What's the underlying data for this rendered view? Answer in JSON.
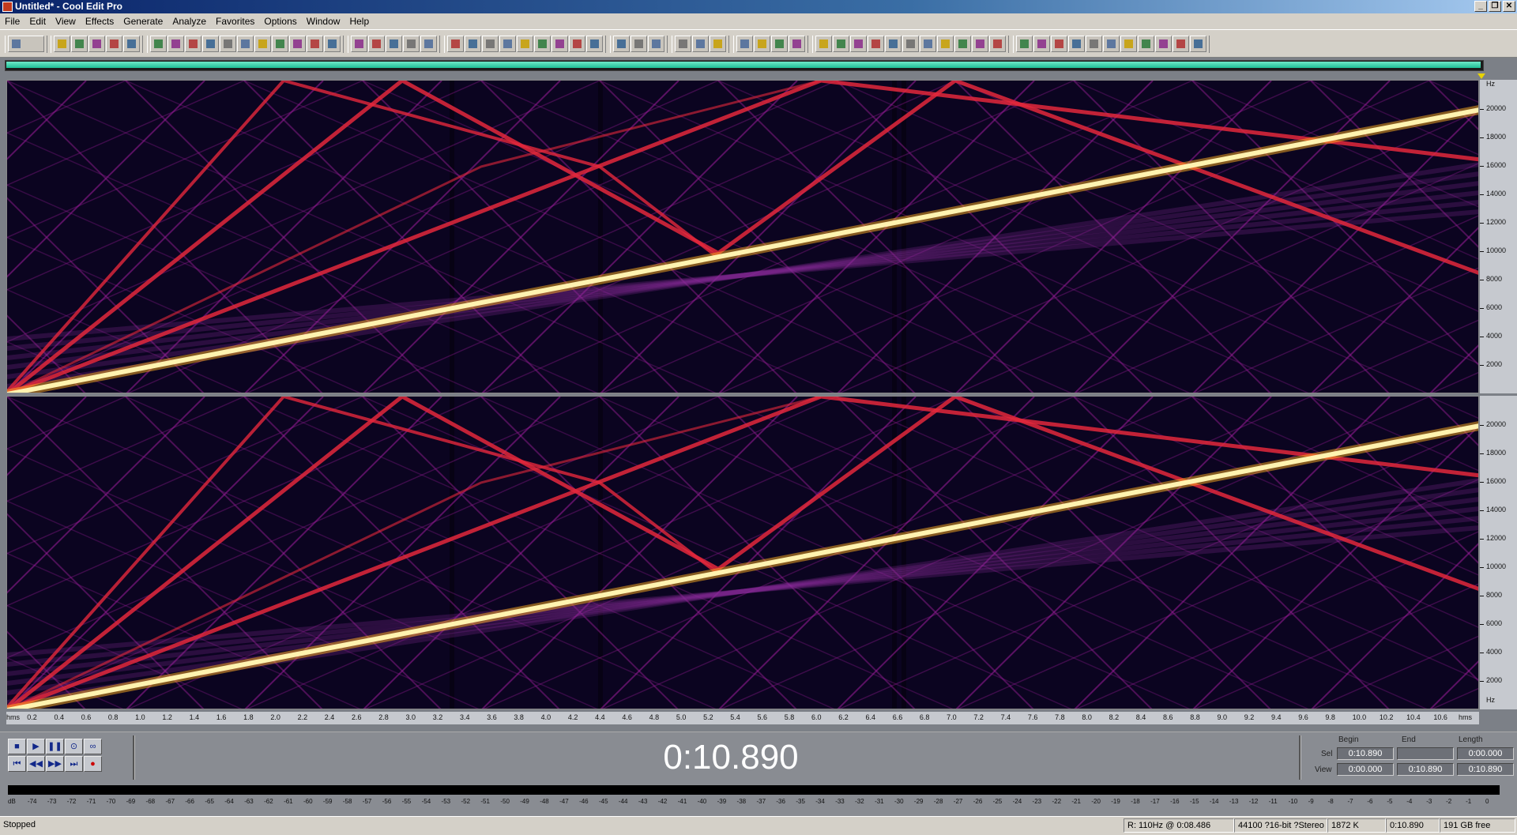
{
  "window": {
    "title": "Untitled* - Cool Edit Pro",
    "min_glyph": "_",
    "max_glyph": "❐",
    "close_glyph": "✕"
  },
  "menu": [
    "File",
    "Edit",
    "View",
    "Effects",
    "Generate",
    "Analyze",
    "Favorites",
    "Options",
    "Window",
    "Help"
  ],
  "toolbar": {
    "groups": [
      {
        "count": 1,
        "wide": true,
        "icons": [
          "waveform-view-icon"
        ]
      },
      {
        "count": 5,
        "icons": [
          "new-file-icon",
          "open-file-icon",
          "save-icon",
          "save-as-icon",
          "close-file-icon"
        ]
      },
      {
        "count": 11,
        "icons": [
          "undo-icon",
          "redo-icon",
          "cut-icon",
          "copy-icon",
          "paste-icon",
          "mix-paste-icon",
          "trim-icon",
          "select-all-icon",
          "zoom-in-icon",
          "zoom-out-icon",
          "zoom-full-icon"
        ]
      },
      {
        "count": 5,
        "icons": [
          "envelope-icon",
          "amplify-icon",
          "spectral-view-icon",
          "waveform-toggle-icon",
          "stereo-icon"
        ]
      },
      {
        "count": 9,
        "icons": [
          "cue-icon",
          "loop-icon",
          "snap-icon",
          "play-head-icon",
          "zoom-icon",
          "time-format-icon",
          "grid-icon",
          "marker-icon",
          "ruler-icon"
        ]
      },
      {
        "count": 3,
        "icons": [
          "settings-icon",
          "options-icon",
          "help-icon"
        ]
      },
      {
        "count": 3,
        "icons": [
          "frequency-analysis-icon",
          "scan-icon",
          "statistics-icon"
        ]
      },
      {
        "count": 4,
        "icons": [
          "delay-icon",
          "reverb-icon",
          "chorus-icon",
          "flanger-icon"
        ]
      },
      {
        "count": 11,
        "icons": [
          "noise-reduction-icon",
          "click-remover-icon",
          "hiss-icon",
          "clip-restore-icon",
          "pitch-icon",
          "stretch-icon",
          "filter-icon",
          "eq-icon",
          "compressor-icon",
          "dynamics-icon",
          "normalize-icon"
        ]
      },
      {
        "count": 11,
        "icons": [
          "spectrum-icon",
          "tone-icon",
          "dtmf-icon",
          "noise-icon",
          "sweep-icon",
          "phase-icon",
          "balance-icon",
          "panner-icon",
          "brainwave-icon",
          "vocal-icon",
          "text-icon"
        ]
      }
    ]
  },
  "overview": {
    "fill_fraction": 1.0
  },
  "spectrogram": {
    "freq_axis": {
      "unit": "Hz",
      "ticks": [
        "20000",
        "18000",
        "16000",
        "14000",
        "12000",
        "10000",
        "8000",
        "6000",
        "4000",
        "2000"
      ]
    },
    "time_axis": {
      "start_label": "hms",
      "end_label": "hms",
      "ticks": [
        "0.2",
        "0.4",
        "0.6",
        "0.8",
        "1.0",
        "1.2",
        "1.4",
        "1.6",
        "1.8",
        "2.0",
        "2.2",
        "2.4",
        "2.6",
        "2.8",
        "3.0",
        "3.2",
        "3.4",
        "3.6",
        "3.8",
        "4.0",
        "4.2",
        "4.4",
        "4.6",
        "4.8",
        "5.0",
        "5.2",
        "5.4",
        "5.6",
        "5.8",
        "6.0",
        "6.2",
        "6.4",
        "6.6",
        "6.8",
        "7.0",
        "7.2",
        "7.4",
        "7.6",
        "7.8",
        "8.0",
        "8.2",
        "8.4",
        "8.6",
        "8.8",
        "9.0",
        "9.2",
        "9.4",
        "9.6",
        "9.8",
        "10.0",
        "10.2",
        "10.4",
        "10.6"
      ]
    },
    "colors": {
      "background": "#0b0420",
      "main": "#fff3b0",
      "harmonic": "#e3283c",
      "alias": "#9c1e9a"
    }
  },
  "transport": {
    "buttons": [
      {
        "name": "stop-button",
        "glyph": "■"
      },
      {
        "name": "play-button",
        "glyph": "▶"
      },
      {
        "name": "pause-button",
        "glyph": "❚❚"
      },
      {
        "name": "play-to-end-button",
        "glyph": "⊙"
      },
      {
        "name": "loop-button",
        "glyph": "∞"
      },
      {
        "name": "go-to-start-button",
        "glyph": "⏮"
      },
      {
        "name": "rewind-button",
        "glyph": "◀◀"
      },
      {
        "name": "fast-forward-button",
        "glyph": "▶▶"
      },
      {
        "name": "go-to-end-button",
        "glyph": "⏭"
      },
      {
        "name": "record-button",
        "glyph": "●"
      }
    ],
    "time": "0:10.890"
  },
  "selection": {
    "headers": {
      "begin": "Begin",
      "end": "End",
      "length": "Length"
    },
    "sel": {
      "label": "Sel",
      "begin": "0:10.890",
      "end": "",
      "length": "0:00.000"
    },
    "view": {
      "label": "View",
      "begin": "0:00.000",
      "end": "0:10.890",
      "length": "0:10.890"
    }
  },
  "levels": {
    "scale": [
      "dB",
      "-74",
      "-73",
      "-72",
      "-71",
      "-70",
      "-69",
      "-68",
      "-67",
      "-66",
      "-65",
      "-64",
      "-63",
      "-62",
      "-61",
      "-60",
      "-59",
      "-58",
      "-57",
      "-56",
      "-55",
      "-54",
      "-53",
      "-52",
      "-51",
      "-50",
      "-49",
      "-48",
      "-47",
      "-46",
      "-45",
      "-44",
      "-43",
      "-42",
      "-41",
      "-40",
      "-39",
      "-38",
      "-37",
      "-36",
      "-35",
      "-34",
      "-33",
      "-32",
      "-31",
      "-30",
      "-29",
      "-28",
      "-27",
      "-26",
      "-25",
      "-24",
      "-23",
      "-22",
      "-21",
      "-20",
      "-19",
      "-18",
      "-17",
      "-16",
      "-15",
      "-14",
      "-13",
      "-12",
      "-11",
      "-10",
      "-9",
      "-8",
      "-7",
      "-6",
      "-5",
      "-4",
      "-3",
      "-2",
      "-1",
      "0"
    ]
  },
  "status": {
    "state": "Stopped",
    "cursor": "R: 110Hz @  0:08.486",
    "format": "44100 ?16-bit ?Stereo",
    "size": "1872 K",
    "duration": "0:10.890",
    "free": "191 GB free"
  }
}
